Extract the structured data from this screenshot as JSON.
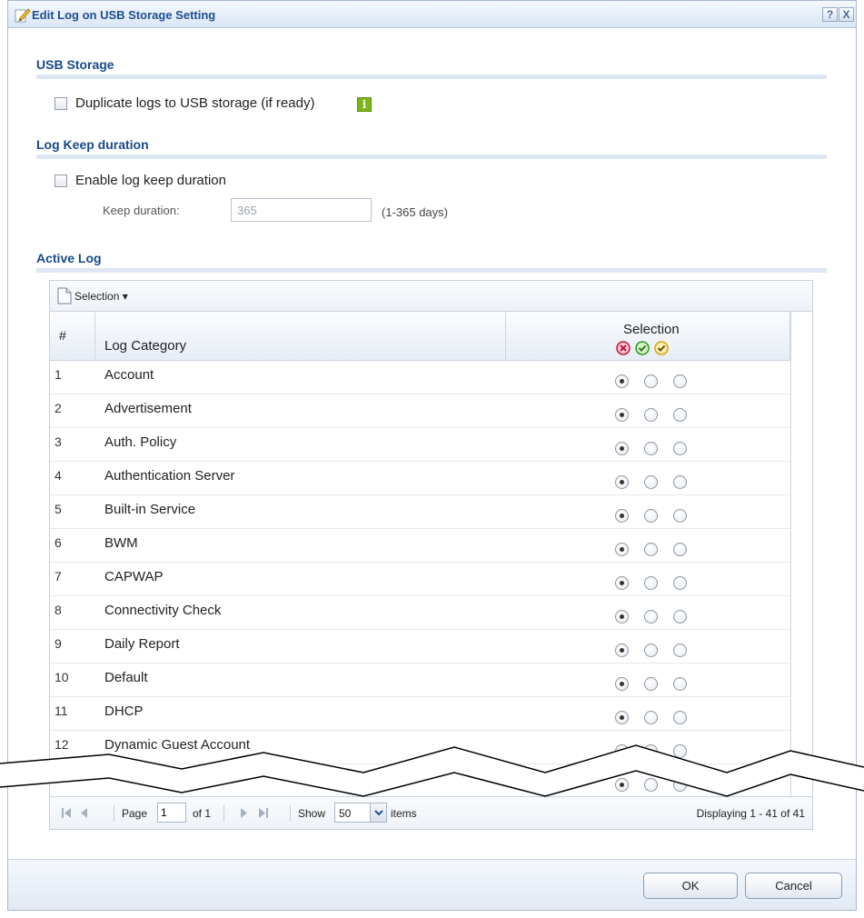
{
  "window": {
    "title": "Edit Log on USB Storage Setting",
    "help_label": "?",
    "close_label": "X"
  },
  "usb_storage": {
    "header": "USB Storage",
    "duplicate_label": "Duplicate logs to USB storage (if ready)",
    "duplicate_checked": false,
    "info_glyph": "i"
  },
  "log_keep": {
    "header": "Log Keep duration",
    "enable_label": "Enable log keep duration",
    "enable_checked": false,
    "keep_label": "Keep duration:",
    "keep_value": "365",
    "keep_hint": "(1-365 days)"
  },
  "active_log": {
    "header": "Active Log",
    "toolbar": {
      "selection_menu": "Selection ▾"
    },
    "columns": {
      "num": "#",
      "category": "Log Category",
      "selection": "Selection"
    },
    "rows": [
      {
        "num": "1",
        "category": "Account",
        "selected": 0
      },
      {
        "num": "2",
        "category": "Advertisement",
        "selected": 0
      },
      {
        "num": "3",
        "category": "Auth. Policy",
        "selected": 0
      },
      {
        "num": "4",
        "category": "Authentication Server",
        "selected": 0
      },
      {
        "num": "5",
        "category": "Built-in Service",
        "selected": 0
      },
      {
        "num": "6",
        "category": "BWM",
        "selected": 0
      },
      {
        "num": "7",
        "category": "CAPWAP",
        "selected": 0
      },
      {
        "num": "8",
        "category": "Connectivity Check",
        "selected": 0
      },
      {
        "num": "9",
        "category": "Daily Report",
        "selected": 0
      },
      {
        "num": "10",
        "category": "Default",
        "selected": 0
      },
      {
        "num": "11",
        "category": "DHCP",
        "selected": 0
      },
      {
        "num": "12",
        "category": "Dynamic Guest Account",
        "selected": 0
      }
    ],
    "pager": {
      "page_label": "Page",
      "page_value": "1",
      "of_label": "of 1",
      "show_label": "Show",
      "show_value": "50",
      "items_label": "items",
      "display_text": "Displaying 1 - 41 of 41"
    }
  },
  "footer": {
    "ok_label": "OK",
    "cancel_label": "Cancel"
  },
  "colors": {
    "section_header": "#184a8c",
    "title_text": "#1b4f93",
    "info_green": "#7cb518",
    "disable_red": "#c0143c",
    "enable_green": "#2e9e1f",
    "debug_yellow": "#d9a400"
  },
  "icons": {
    "title": "edit-pencil-icon",
    "info": "info-icon",
    "toolbar": "document-icon",
    "selection_header": [
      "disable-log-icon",
      "enable-normal-log-icon",
      "enable-debug-log-icon"
    ],
    "pager": [
      "first-page-icon",
      "previous-page-icon",
      "next-page-icon",
      "last-page-icon"
    ]
  }
}
